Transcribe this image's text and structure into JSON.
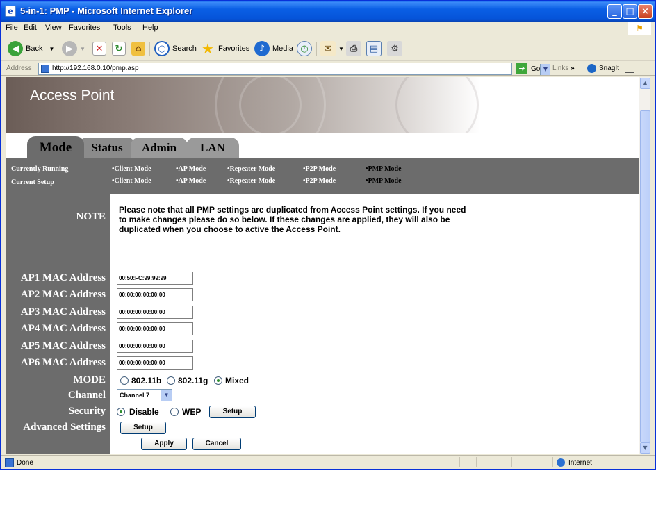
{
  "window": {
    "title": "5-in-1: PMP - Microsoft Internet Explorer",
    "min": "_",
    "max": "□",
    "close": "×"
  },
  "menu": [
    "File",
    "Edit",
    "View",
    "Favorites",
    "Tools",
    "Help"
  ],
  "toolbar": {
    "back": "Back",
    "search": "Search",
    "favorites": "Favorites",
    "media": "Media"
  },
  "address": {
    "label": "Address",
    "url": "http://192.168.0.10/pmp.asp",
    "go": "Go",
    "links": "Links",
    "links_more": "»",
    "snagit": "SnagIt"
  },
  "banner": {
    "title": "Access Point"
  },
  "tabs": {
    "mode": "Mode",
    "status": "Status",
    "admin": "Admin",
    "lan": "LAN"
  },
  "modes": {
    "running_label": "Currently Running",
    "setup_label": "Current Setup",
    "items": [
      "•Client Mode",
      "•AP Mode",
      "•Repeater Mode",
      "•P2P Mode",
      "•PMP Mode"
    ]
  },
  "note": {
    "label": "NOTE",
    "text": "Please note that all PMP settings are duplicated from Access Point settings. If you need to make changes please do so below. If these changes are applied, they will also be duplicated when you choose to active the Access Point."
  },
  "macs": [
    {
      "label": "AP1 MAC Address",
      "value": "00:50:FC:99:99:99"
    },
    {
      "label": "AP2 MAC Address",
      "value": "00:00:00:00:00:00"
    },
    {
      "label": "AP3 MAC Address",
      "value": "00:00:00:00:00:00"
    },
    {
      "label": "AP4 MAC Address",
      "value": "00:00:00:00:00:00"
    },
    {
      "label": "AP5 MAC Address",
      "value": "00:00:00:00:00:00"
    },
    {
      "label": "AP6 MAC Address",
      "value": "00:00:00:00:00:00"
    }
  ],
  "mode_field": {
    "label": "MODE",
    "opt_b": "802.11b",
    "opt_g": "802.11g",
    "opt_mixed": "Mixed",
    "selected": "Mixed"
  },
  "channel": {
    "label": "Channel",
    "value": "Channel 7"
  },
  "security": {
    "label": "Security",
    "opt_disable": "Disable",
    "opt_wep": "WEP",
    "setup": "Setup",
    "selected": "Disable"
  },
  "advanced": {
    "label": "Advanced Settings",
    "setup": "Setup"
  },
  "actions": {
    "apply": "Apply",
    "cancel": "Cancel"
  },
  "status": {
    "left": "Done",
    "zone": "Internet"
  }
}
